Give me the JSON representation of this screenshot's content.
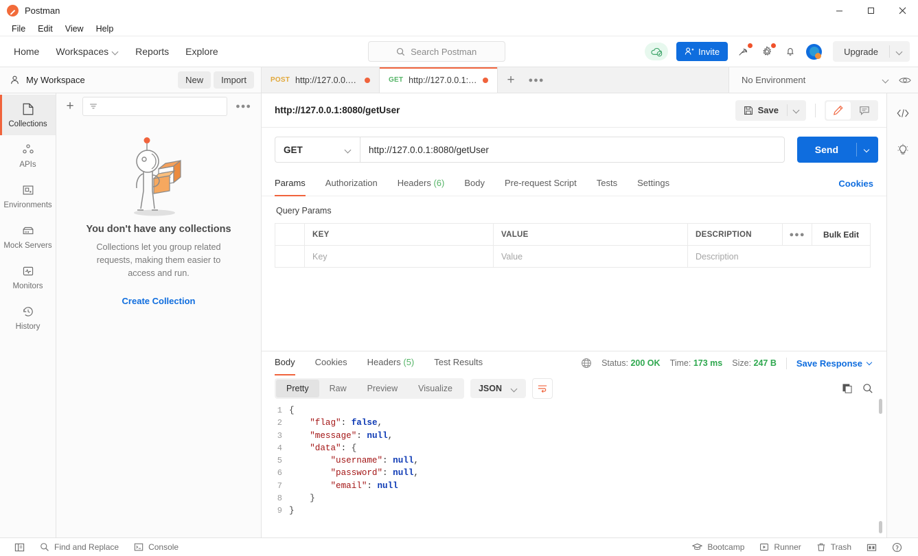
{
  "window": {
    "title": "Postman",
    "logo_icon": "postman-logo",
    "minimize_icon": "minimize-icon",
    "maximize_icon": "maximize-icon",
    "close_icon": "close-icon"
  },
  "menubar": {
    "items": [
      "File",
      "Edit",
      "View",
      "Help"
    ]
  },
  "topnav": {
    "links": [
      {
        "label": "Home",
        "caret": false
      },
      {
        "label": "Workspaces",
        "caret": true
      },
      {
        "label": "Reports",
        "caret": false
      },
      {
        "label": "Explore",
        "caret": false
      }
    ],
    "search": {
      "placeholder": "Search Postman",
      "icon": "search-icon"
    },
    "sync_icon": "cloud-sync-icon",
    "invite": {
      "label": "Invite",
      "icon": "user-plus-icon"
    },
    "icons": [
      "satellite-icon",
      "gear-icon",
      "bell-icon",
      "avatar-icon"
    ],
    "upgrade": {
      "label": "Upgrade",
      "caret_icon": "chevron-down-icon"
    }
  },
  "workspace": {
    "name": "My Workspace",
    "icon": "user-icon",
    "new_label": "New",
    "import_label": "Import"
  },
  "tabs": [
    {
      "method": "POST",
      "url": "http://127.0.0.1:8...",
      "active": false,
      "unsaved": true
    },
    {
      "method": "GET",
      "url": "http://127.0.0.1:80...",
      "active": true,
      "unsaved": true
    }
  ],
  "tab_actions": {
    "new_tab_icon": "plus-icon",
    "more_icon": "ellipsis-icon"
  },
  "environment": {
    "selected": "No Environment",
    "caret_icon": "chevron-down-icon",
    "eye_icon": "eye-icon"
  },
  "rail": {
    "items": [
      {
        "label": "Collections",
        "icon": "collections-icon",
        "active": true
      },
      {
        "label": "APIs",
        "icon": "apis-icon",
        "active": false
      },
      {
        "label": "Environments",
        "icon": "environments-icon",
        "active": false
      },
      {
        "label": "Mock Servers",
        "icon": "mock-servers-icon",
        "active": false
      },
      {
        "label": "Monitors",
        "icon": "monitors-icon",
        "active": false
      },
      {
        "label": "History",
        "icon": "history-icon",
        "active": false
      }
    ]
  },
  "sidebar": {
    "add_icon": "plus-icon",
    "filter_icon": "filter-icon",
    "more_icon": "ellipsis-icon",
    "empty": {
      "illustration": "astronaut-with-boxes-illustration",
      "title": "You don't have any collections",
      "subtitle": "Collections let you group related requests, making them easier to access and run.",
      "cta": "Create Collection"
    }
  },
  "request": {
    "title": "http://127.0.0.1:8080/getUser",
    "save": {
      "label": "Save",
      "icon": "save-icon",
      "caret_icon": "chevron-down-icon"
    },
    "edit_icon": "pencil-icon",
    "comment_icon": "comment-icon",
    "method": "GET",
    "method_caret_icon": "chevron-down-icon",
    "url": "http://127.0.0.1:8080/getUser",
    "send": {
      "label": "Send",
      "caret_icon": "chevron-down-icon"
    },
    "tabs": [
      {
        "label": "Params",
        "count": "",
        "active": true
      },
      {
        "label": "Authorization",
        "count": "",
        "active": false
      },
      {
        "label": "Headers",
        "count": "(6)",
        "active": false
      },
      {
        "label": "Body",
        "count": "",
        "active": false
      },
      {
        "label": "Pre-request Script",
        "count": "",
        "active": false
      },
      {
        "label": "Tests",
        "count": "",
        "active": false
      },
      {
        "label": "Settings",
        "count": "",
        "active": false
      }
    ],
    "cookies_link": "Cookies",
    "query_params": {
      "label": "Query Params",
      "headers": [
        "KEY",
        "VALUE",
        "DESCRIPTION"
      ],
      "more_icon": "ellipsis-icon",
      "bulk_edit": "Bulk Edit",
      "rows": [
        {
          "key": "Key",
          "value": "Value",
          "description": "Description"
        }
      ]
    }
  },
  "response": {
    "tabs": [
      {
        "label": "Body",
        "count": "",
        "active": true
      },
      {
        "label": "Cookies",
        "count": "",
        "active": false
      },
      {
        "label": "Headers",
        "count": "(5)",
        "active": false
      },
      {
        "label": "Test Results",
        "count": "",
        "active": false
      }
    ],
    "globe_icon": "globe-icon",
    "status_label": "Status:",
    "status_value": "200 OK",
    "time_label": "Time:",
    "time_value": "173 ms",
    "size_label": "Size:",
    "size_value": "247 B",
    "save_response": {
      "label": "Save Response",
      "caret_icon": "chevron-down-icon"
    },
    "formats": [
      {
        "label": "Pretty",
        "active": true
      },
      {
        "label": "Raw",
        "active": false
      },
      {
        "label": "Preview",
        "active": false
      },
      {
        "label": "Visualize",
        "active": false
      }
    ],
    "language": "JSON",
    "language_caret_icon": "chevron-down-icon",
    "wrap_icon": "word-wrap-icon",
    "copy_icon": "copy-icon",
    "search_icon": "search-icon",
    "body_lines": [
      {
        "n": "1",
        "indent": 0,
        "key": "",
        "sep": "",
        "value": "{",
        "vtype": "brace",
        "comma": ""
      },
      {
        "n": "2",
        "indent": 1,
        "key": "\"flag\"",
        "sep": ": ",
        "value": "false",
        "vtype": "lit",
        "comma": ","
      },
      {
        "n": "3",
        "indent": 1,
        "key": "\"message\"",
        "sep": ": ",
        "value": "null",
        "vtype": "lit",
        "comma": ","
      },
      {
        "n": "4",
        "indent": 1,
        "key": "\"data\"",
        "sep": ": ",
        "value": "{",
        "vtype": "brace",
        "comma": ""
      },
      {
        "n": "5",
        "indent": 2,
        "key": "\"username\"",
        "sep": ": ",
        "value": "null",
        "vtype": "lit",
        "comma": ","
      },
      {
        "n": "6",
        "indent": 2,
        "key": "\"password\"",
        "sep": ": ",
        "value": "null",
        "vtype": "lit",
        "comma": ","
      },
      {
        "n": "7",
        "indent": 2,
        "key": "\"email\"",
        "sep": ": ",
        "value": "null",
        "vtype": "lit",
        "comma": ""
      },
      {
        "n": "8",
        "indent": 1,
        "key": "",
        "sep": "",
        "value": "}",
        "vtype": "brace",
        "comma": ""
      },
      {
        "n": "9",
        "indent": 0,
        "key": "",
        "sep": "",
        "value": "}",
        "vtype": "brace",
        "comma": ""
      }
    ],
    "body_json": {
      "flag": false,
      "message": null,
      "data": {
        "username": null,
        "password": null,
        "email": null
      }
    }
  },
  "right_rail": {
    "icons": [
      "code-icon",
      "lightbulb-icon"
    ]
  },
  "statusbar": {
    "left": [
      {
        "label": "",
        "icon": "sidebar-toggle-icon"
      },
      {
        "label": "Find and Replace",
        "icon": "search-icon"
      },
      {
        "label": "Console",
        "icon": "terminal-icon"
      }
    ],
    "right": [
      {
        "label": "Bootcamp",
        "icon": "graduation-cap-icon"
      },
      {
        "label": "Runner",
        "icon": "play-icon"
      },
      {
        "label": "Trash",
        "icon": "trash-icon"
      },
      {
        "label": "",
        "icon": "layout-icon"
      },
      {
        "label": "",
        "icon": "help-icon"
      }
    ]
  },
  "colors": {
    "accent_orange": "#f0633c",
    "primary_blue": "#0f6dde",
    "success_green": "#2fa84f",
    "get_green": "#55b467",
    "post_yellow": "#e2a83a"
  }
}
